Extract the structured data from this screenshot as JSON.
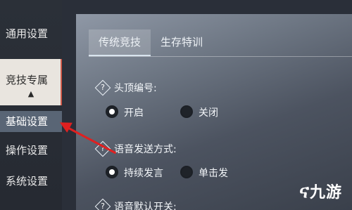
{
  "sidebar": {
    "items": [
      {
        "label": "通用设置"
      },
      {
        "label": "竞技专属"
      },
      {
        "label": "基础设置"
      },
      {
        "label": "操作设置"
      },
      {
        "label": "系统设置"
      }
    ],
    "expand_glyph": "▲"
  },
  "tabs": [
    {
      "label": "传统竞技"
    },
    {
      "label": "生存特训"
    }
  ],
  "settings": [
    {
      "label": "头顶编号:",
      "options": [
        "开启",
        "关闭"
      ],
      "selected": 0
    },
    {
      "label": "语音发送方式:",
      "options": [
        "持续发言",
        "单击发"
      ],
      "selected": 0
    },
    {
      "label": "语音默认开关:"
    }
  ],
  "help_glyph": "?",
  "watermark": {
    "mark": "ና",
    "text": "九游"
  },
  "colors": {
    "annotation_arrow": "#e02020",
    "active_bg": "#e9e5df",
    "subactive_bg": "#596575"
  }
}
